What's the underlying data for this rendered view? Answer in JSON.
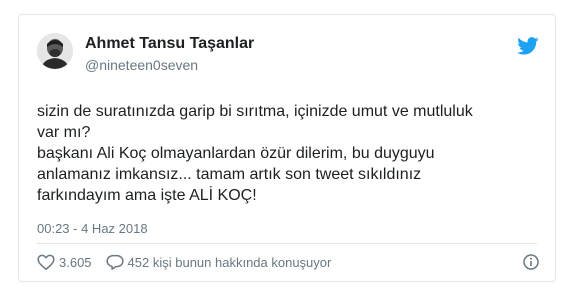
{
  "tweet": {
    "author_name": "Ahmet Tansu Taşanlar",
    "author_handle": "@nineteen0seven",
    "lines": [
      "sizin de suratınızda garip bi sırıtma, içinizde umut ve mutluluk",
      "var mı?",
      "başkanı Ali Koç olmayanlardan özür dilerim, bu duyguyu",
      "anlamanız imkansız... tamam artık son tweet sıkıldınız",
      "farkındayım ama işte ALİ KOÇ!"
    ],
    "timestamp": "00:23 - 4 Haz 2018",
    "likes": "3.605",
    "replies_text": "452 kişi bunun hakkında konuşuyor"
  },
  "colors": {
    "twitter_blue": "#1da1f2",
    "text": "#1c2022",
    "muted": "#697882",
    "border": "#e1e8ed"
  },
  "icons": [
    "avatar",
    "twitter-bird-icon",
    "heart-icon",
    "reply-bubble-icon",
    "info-icon"
  ]
}
